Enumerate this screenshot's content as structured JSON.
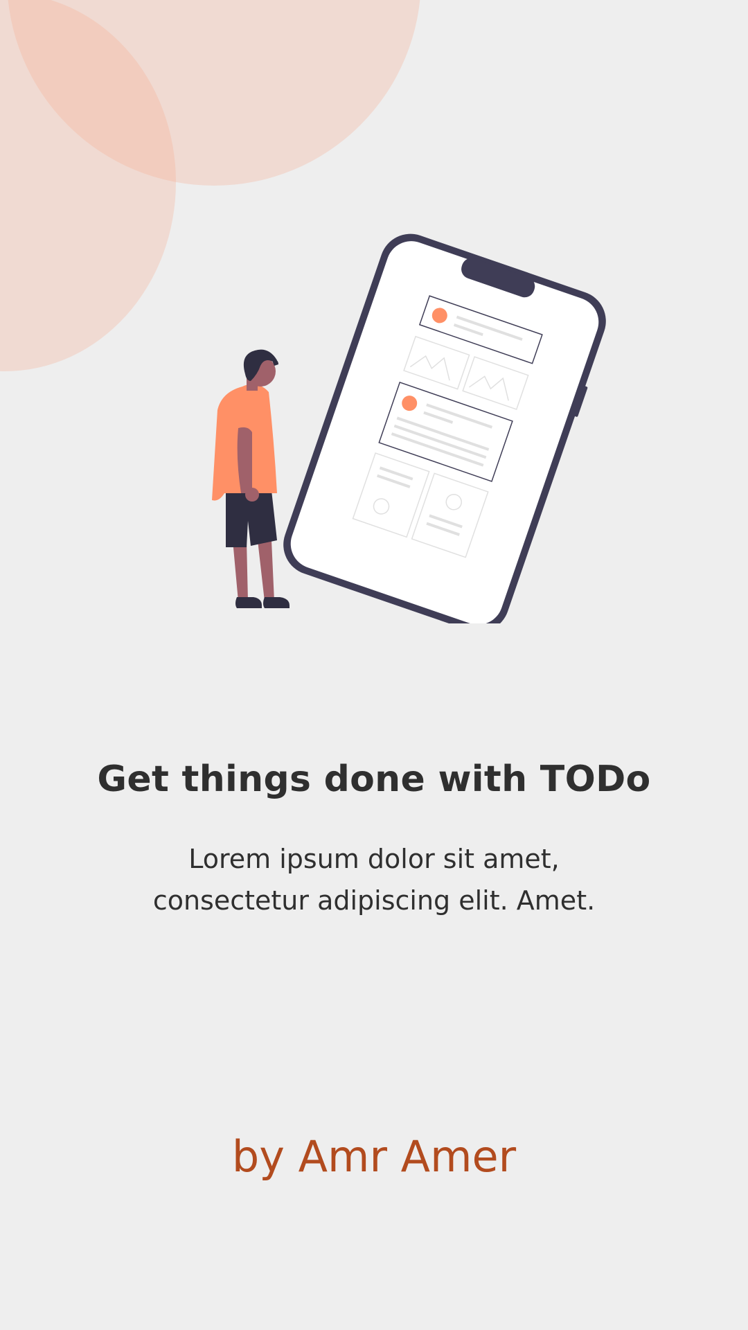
{
  "onboarding": {
    "title": "Get things done with TODo",
    "description": "Lorem ipsum dolor sit amet, consectetur adipiscing elit. Amet.",
    "author": "by Amr Amer"
  },
  "illustration": {
    "name": "person-looking-at-phone-illustration"
  },
  "colors": {
    "background": "#EEEEEE",
    "accent": "#F9A98C",
    "accent_strong": "#FF9066",
    "text_primary": "#2F2F2F",
    "author": "#B24B1E",
    "phone_frame": "#3F3D56"
  }
}
